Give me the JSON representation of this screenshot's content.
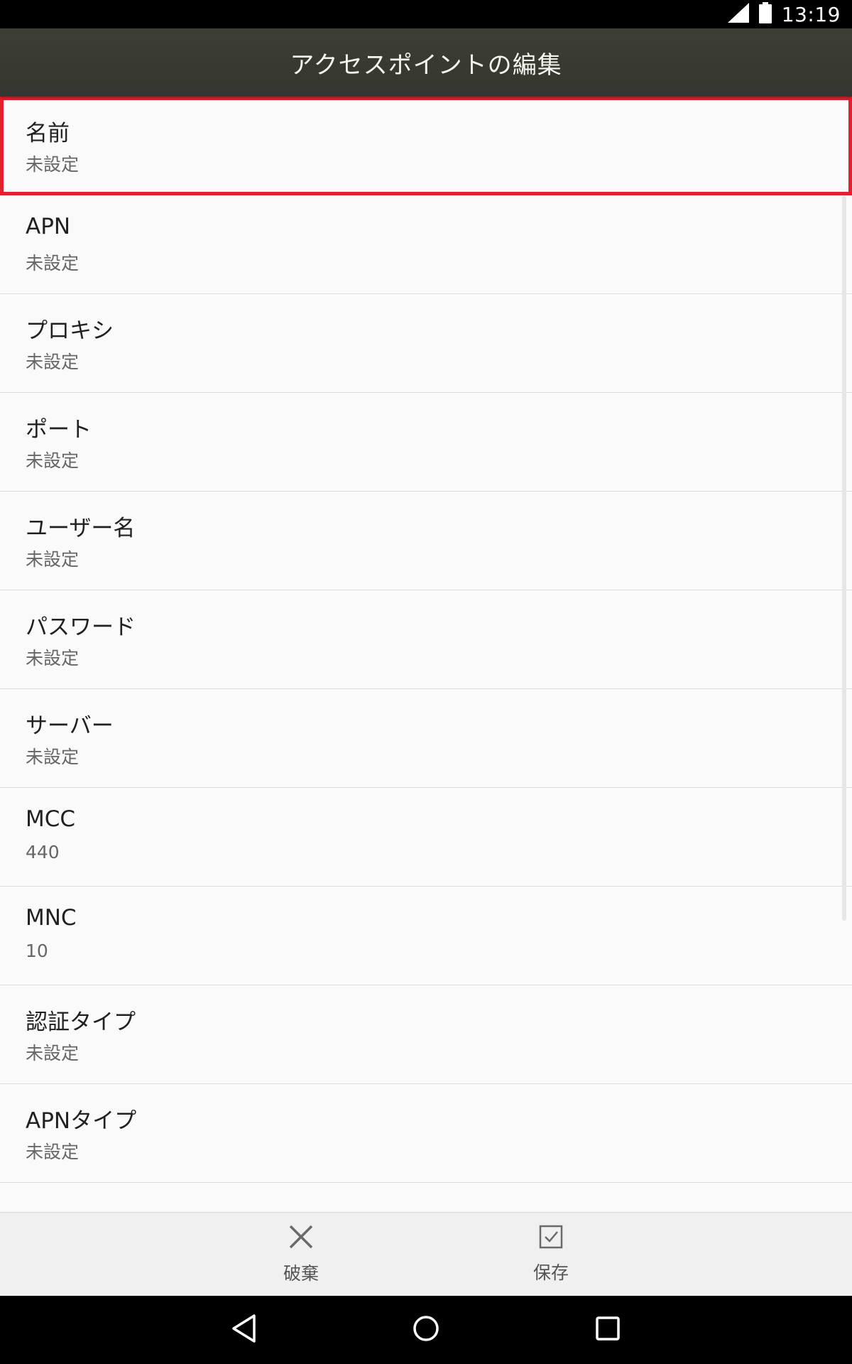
{
  "status_bar": {
    "time": "13:19",
    "signal_icon": "signal-icon",
    "battery_icon": "battery-icon"
  },
  "app_bar": {
    "title": "アクセスポイントの編集"
  },
  "list": {
    "items": [
      {
        "title": "名前",
        "value": "未設定"
      },
      {
        "title": "APN",
        "value": "未設定"
      },
      {
        "title": "プロキシ",
        "value": "未設定"
      },
      {
        "title": "ポート",
        "value": "未設定"
      },
      {
        "title": "ユーザー名",
        "value": "未設定"
      },
      {
        "title": "パスワード",
        "value": "未設定"
      },
      {
        "title": "サーバー",
        "value": "未設定"
      },
      {
        "title": "MCC",
        "value": "440"
      },
      {
        "title": "MNC",
        "value": "10"
      },
      {
        "title": "認証タイプ",
        "value": "未設定"
      },
      {
        "title": "APNタイプ",
        "value": "未設定"
      }
    ]
  },
  "actions": {
    "discard_label": "破棄",
    "save_label": "保存"
  },
  "colors": {
    "highlight": "#e0222c",
    "app_bar": "#3a3c34"
  }
}
